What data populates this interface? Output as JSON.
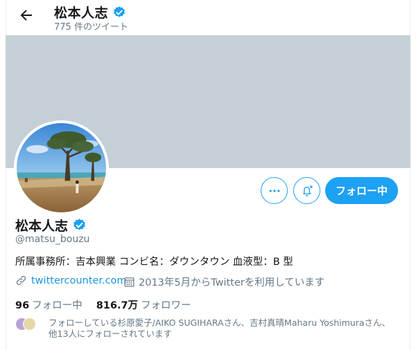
{
  "header": {
    "title": "松本人志",
    "tweet_count": "775 件のツイート"
  },
  "actions": {
    "more_icon": "more-horizontal-icon",
    "bell_icon": "bell-plus-icon",
    "follow_label": "フォロー中"
  },
  "profile": {
    "name": "松本人志",
    "handle": "@matsu_bouzu",
    "bio": "所属事務所：吉本興業 コンビ名：ダウンタウン 血液型：B 型",
    "link": "twittercounter.com",
    "joined": "2013年5月からTwitterを利用しています"
  },
  "stats": {
    "following_count": "96",
    "following_label": "フォロー中",
    "followers_count": "816.7万",
    "followers_label": "フォロワー"
  },
  "followed_by": {
    "text": "フォローしている杉原愛子/AIKO SUGIHARAさん、吉村真晴Maharu Yoshimuraさん、他13人にフォローされています"
  },
  "colors": {
    "accent": "#1da1f2",
    "banner": "#c5cfd6",
    "secondary_text": "#657786",
    "link": "#1b95e0"
  }
}
